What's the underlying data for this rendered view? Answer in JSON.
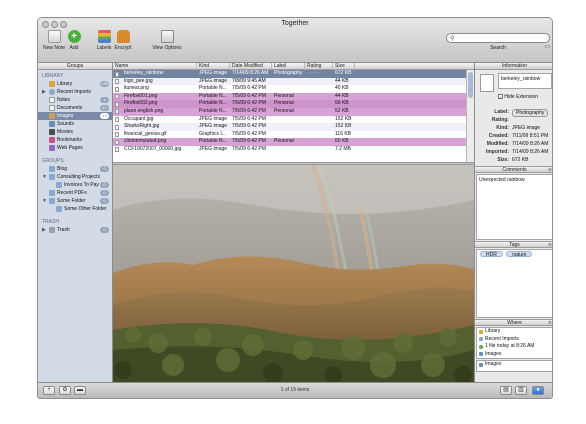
{
  "window": {
    "title": "Together"
  },
  "toolbar": {
    "items": [
      {
        "label": "New Note",
        "icon": "new-note-icon"
      },
      {
        "label": "Add",
        "icon": "add-icon"
      },
      {
        "label": "Labels",
        "icon": "labels-icon"
      },
      {
        "label": "Encrypt",
        "icon": "encrypt-icon"
      },
      {
        "label": "View Options",
        "icon": "view-options-icon"
      }
    ],
    "search_label": "Search",
    "search_placeholder": ""
  },
  "sidebar": {
    "title": "Groups",
    "sections": {
      "library": "LIBRARY",
      "groups": "GROUPS",
      "trash": "TRASH"
    },
    "library_items": [
      {
        "label": "Library",
        "count": "135",
        "color": "#d9a43a"
      },
      {
        "label": "Recent Imports",
        "count": "",
        "color": "#8aa7c8"
      },
      {
        "label": "Notes",
        "count": "1",
        "color": "#e7e7e7"
      },
      {
        "label": "Documents",
        "count": "87",
        "color": "#e7e7e7"
      },
      {
        "label": "Images",
        "count": "19",
        "color": "#6e8fb5"
      },
      {
        "label": "Sounds",
        "count": "",
        "color": "#6e8fb5"
      },
      {
        "label": "Movies",
        "count": "",
        "color": "#4d4d4d"
      },
      {
        "label": "Bookmarks",
        "count": "",
        "color": "#c94f8b"
      },
      {
        "label": "Web Pages",
        "count": "",
        "color": "#8e6bb0"
      }
    ],
    "group_items": [
      {
        "label": "Blog",
        "count": "0",
        "color": "#88a9d2"
      },
      {
        "label": "Consulting Projects",
        "count": "",
        "color": "#88a9d2"
      },
      {
        "label": "Invoices To Pay",
        "count": "0",
        "color": "#88a9d2"
      },
      {
        "label": "Recent PDFs",
        "count": "0",
        "color": "#88a9d2"
      },
      {
        "label": "Some Folder",
        "count": "0",
        "color": "#88a9d2"
      },
      {
        "label": "Some Other Folder",
        "count": "",
        "color": "#88a9d2"
      }
    ],
    "trash_items": [
      {
        "label": "Trash",
        "count": "0",
        "color": "#9aa2ad"
      }
    ]
  },
  "table": {
    "columns": [
      "Name",
      "Kind",
      "Date Modified",
      "Label",
      "Rating",
      "Size"
    ],
    "rows": [
      {
        "name": "berkeley_rainbow",
        "kind": "JPEG image",
        "date": "7/14/09 8:26 AM",
        "label": "Photography",
        "rating": "· · · · ·",
        "size": "672 KB",
        "style": "sel"
      },
      {
        "name": "logo_pee.jpg",
        "kind": "JPEG image",
        "date": "7/8/09 9:45 AM",
        "label": "",
        "rating": "",
        "size": "44 KB",
        "style": ""
      },
      {
        "name": "itunear.png",
        "kind": "Portable N...",
        "date": "7/5/09 6:42 PM",
        "label": "",
        "rating": "",
        "size": "40 KB",
        "style": ""
      },
      {
        "name": "Firefox001.png",
        "kind": "Portable N...",
        "date": "7/5/09 6:42 PM",
        "label": "Personal",
        "rating": "",
        "size": "44 KB",
        "style": "pink"
      },
      {
        "name": "Firefox002.png",
        "kind": "Portable N...",
        "date": "7/5/09 6:42 PM",
        "label": "Personal",
        "rating": "",
        "size": "56 KB",
        "style": "pink2"
      },
      {
        "name": "plane english.png",
        "kind": "Portable N...",
        "date": "7/5/09 6:42 PM",
        "label": "Personal",
        "rating": "",
        "size": "52 KB",
        "style": "pink"
      },
      {
        "name": "Occupant.jpg",
        "kind": "JPEG image",
        "date": "7/5/09 6:42 PM",
        "label": "",
        "rating": "",
        "size": "152 KB",
        "style": ""
      },
      {
        "name": "SharksRight.jpg",
        "kind": "JPEG image",
        "date": "7/5/09 6:42 PM",
        "label": "",
        "rating": "",
        "size": "152 KB",
        "style": "alt"
      },
      {
        "name": "financial_genius.gif",
        "kind": "Graphics I...",
        "date": "7/5/09 6:42 PM",
        "label": "",
        "rating": "",
        "size": "116 KB",
        "style": ""
      },
      {
        "name": "clintonmutated.png",
        "kind": "Portable N...",
        "date": "7/5/09 6:42 PM",
        "label": "Personal",
        "rating": "",
        "size": "60 KB",
        "style": "pink"
      },
      {
        "name": "CCF19072007_00000.jpg",
        "kind": "JPEG image",
        "date": "7/5/09 6:42 PM",
        "label": "",
        "rating": "",
        "size": "7.2 MB",
        "style": ""
      }
    ]
  },
  "inspector": {
    "information_title": "Information",
    "filename": "berkeley_rainbow",
    "hide_extension": "Hide Extension",
    "fields": [
      {
        "key": "Label:",
        "value": "Photography"
      },
      {
        "key": "Rating:",
        "value": ""
      },
      {
        "key": "Kind:",
        "value": "JPEG image"
      },
      {
        "key": "Created:",
        "value": "7/11/09 8:51 PM"
      },
      {
        "key": "Modified:",
        "value": "7/14/09 8:26 AM"
      },
      {
        "key": "Imported:",
        "value": "7/14/09 8:26 AM"
      },
      {
        "key": "Size:",
        "value": "672 KB"
      }
    ],
    "comments_title": "Comments",
    "comment": "Unexpected rainbow",
    "tags_title": "Tags",
    "tags": [
      "HDR",
      "nature"
    ],
    "where_title": "Where",
    "where_items": [
      {
        "label": "Library",
        "color": "#d9a43a"
      },
      {
        "label": "Recent Imports",
        "color": "#8aa7c8"
      },
      {
        "label": "1 file today at 8:26 AM",
        "color": "#6aa84f"
      },
      {
        "label": "Images",
        "color": "#6e8fb5"
      }
    ],
    "where_bottom": "Images"
  },
  "status": {
    "text": "1 of 19 items"
  }
}
